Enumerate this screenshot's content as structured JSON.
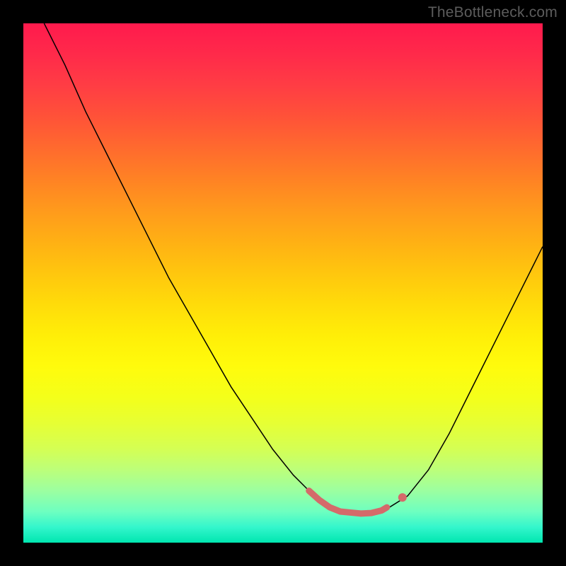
{
  "watermark": "TheBottleneck.com",
  "chart_data": {
    "type": "line",
    "title": "",
    "xlabel": "",
    "ylabel": "",
    "xlim": [
      0,
      100
    ],
    "ylim": [
      0,
      100
    ],
    "series": [
      {
        "name": "curve",
        "color": "#000000",
        "width": 1.5,
        "x": [
          4,
          8,
          12,
          16,
          20,
          24,
          28,
          32,
          36,
          40,
          44,
          48,
          52,
          55,
          58,
          60,
          63,
          66,
          70,
          74,
          78,
          82,
          86,
          90,
          94,
          98,
          100
        ],
        "y": [
          100,
          92,
          83,
          75,
          67,
          59,
          51,
          44,
          37,
          30,
          24,
          18,
          13,
          10,
          8,
          6.5,
          5.8,
          5.5,
          6.5,
          9,
          14,
          21,
          29,
          37,
          45,
          53,
          57
        ]
      },
      {
        "name": "highlight",
        "color": "#d46a6a",
        "width": 9,
        "linecap": "round",
        "x": [
          55,
          57,
          59,
          61,
          63,
          65,
          67,
          69,
          70
        ],
        "y": [
          10,
          8.2,
          6.8,
          6.0,
          5.8,
          5.6,
          5.7,
          6.2,
          6.8
        ]
      },
      {
        "name": "highlight-dot",
        "color": "#d46a6a",
        "type_hint": "marker",
        "radius": 6,
        "x": [
          73
        ],
        "y": [
          8.7
        ]
      }
    ]
  }
}
